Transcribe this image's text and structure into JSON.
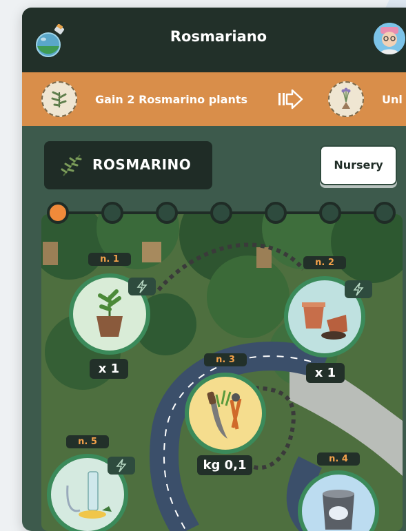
{
  "header": {
    "title": "Rosmariano",
    "flask_icon": "potion-flask-icon",
    "avatar_icon": "user-avatar-icon"
  },
  "banner": {
    "goal_text": "Gain 2 Rosmarino plants",
    "next_text": "Unl",
    "arrow_icon": "next-arrow-icon"
  },
  "plant": {
    "name": "ROSMARINO",
    "icon": "rosemary-sprig-icon"
  },
  "nursery_label": "Nursery",
  "progress": {
    "total_steps": 7,
    "current_step": 1
  },
  "steps": [
    {
      "num": "n. 1",
      "qty": "x 1",
      "icon": "potted-plant-icon"
    },
    {
      "num": "n. 2",
      "qty": "x 1",
      "icon": "clay-pots-icon"
    },
    {
      "num": "n. 3",
      "qty": "kg 0,1",
      "icon": "garden-tools-icon"
    },
    {
      "num": "n. 4",
      "qty": "",
      "icon": "metal-bucket-icon"
    },
    {
      "num": "n. 5",
      "qty": "",
      "icon": "glass-still-icon"
    }
  ],
  "colors": {
    "header_bg": "#223029",
    "banner_bg": "#d98e4a",
    "panel_bg": "#3d5a4c",
    "active_step": "#f08a3a",
    "step_label": "#f3a14a"
  }
}
